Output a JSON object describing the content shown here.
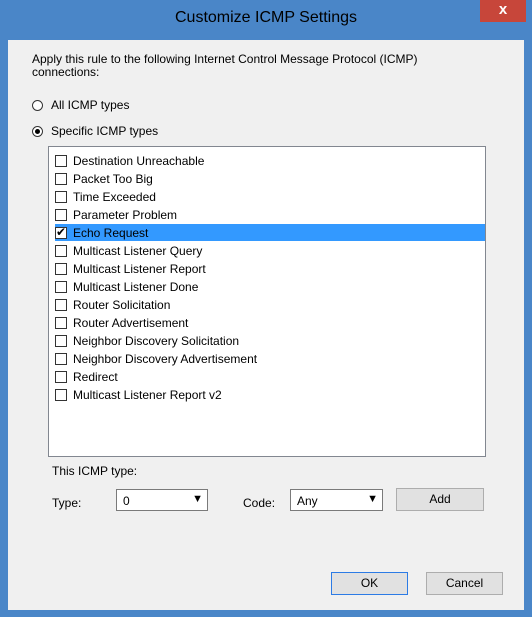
{
  "window": {
    "title": "Customize ICMP Settings",
    "close_glyph": "x"
  },
  "intro_text": "Apply this rule to the following Internet Control Message Protocol (ICMP) connections:",
  "radios": [
    {
      "label": "All ICMP types",
      "checked": false
    },
    {
      "label": "Specific ICMP types",
      "checked": true
    }
  ],
  "icmp_list": [
    {
      "label": "Destination Unreachable",
      "checked": false,
      "selected": false
    },
    {
      "label": "Packet Too Big",
      "checked": false,
      "selected": false
    },
    {
      "label": "Time Exceeded",
      "checked": false,
      "selected": false
    },
    {
      "label": "Parameter Problem",
      "checked": false,
      "selected": false
    },
    {
      "label": "Echo Request",
      "checked": true,
      "selected": true
    },
    {
      "label": "Multicast Listener Query",
      "checked": false,
      "selected": false
    },
    {
      "label": "Multicast Listener Report",
      "checked": false,
      "selected": false
    },
    {
      "label": "Multicast Listener Done",
      "checked": false,
      "selected": false
    },
    {
      "label": "Router Solicitation",
      "checked": false,
      "selected": false
    },
    {
      "label": "Router Advertisement",
      "checked": false,
      "selected": false
    },
    {
      "label": "Neighbor Discovery Solicitation",
      "checked": false,
      "selected": false
    },
    {
      "label": "Neighbor Discovery Advertisement",
      "checked": false,
      "selected": false
    },
    {
      "label": "Redirect",
      "checked": false,
      "selected": false
    },
    {
      "label": "Multicast Listener Report v2",
      "checked": false,
      "selected": false
    }
  ],
  "this_type": {
    "section_label": "This ICMP type:",
    "type_label": "Type:",
    "type_value": "0",
    "code_label": "Code:",
    "code_value": "Any",
    "add_label": "Add"
  },
  "buttons": {
    "ok": "OK",
    "cancel": "Cancel"
  },
  "colors": {
    "titlebar": "#4a86c8",
    "close": "#c7463a",
    "selection": "#3399ff",
    "dialog_bg": "#f0f0f0"
  }
}
